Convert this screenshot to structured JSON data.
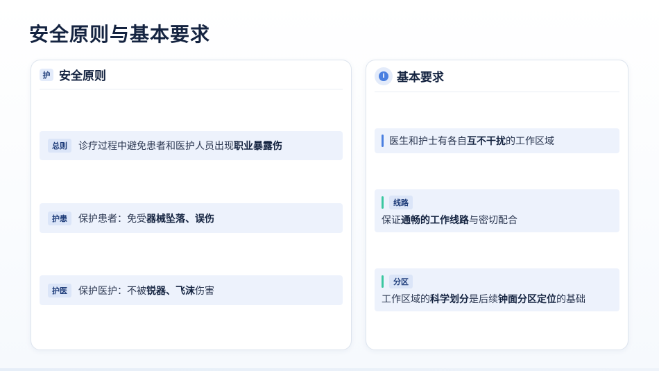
{
  "page": {
    "title": "安全原则与基本要求"
  },
  "left_card": {
    "icon_text": "护",
    "title": "安全原则",
    "rows": [
      {
        "tag": "总则",
        "text_pre": "诊疗过程中避免患者和医护人员出现",
        "text_bold": "职业暴露伤",
        "text_post": ""
      },
      {
        "tag": "护患",
        "text_pre": "保护患者：免受",
        "text_bold": "器械坠落、误伤",
        "text_post": ""
      },
      {
        "tag": "护医",
        "text_pre": "保护医护：不被",
        "text_bold": "锐器、飞沫",
        "text_post": "伤害"
      }
    ]
  },
  "right_card": {
    "icon_name": "info-icon",
    "icon_text": "i",
    "title": "基本要求",
    "item1": {
      "text_pre": "医生和护士有各自",
      "text_bold": "互不干扰",
      "text_post": "的工作区域"
    },
    "item2": {
      "tag": "线路",
      "text_pre": "保证",
      "text_bold": "通畅的工作线路",
      "text_post": "与密切配合"
    },
    "item3": {
      "tag": "分区",
      "text_pre": "工作区域的",
      "text_bold1": "科学划分",
      "text_mid": "是后续",
      "text_bold2": "钟面分区定位",
      "text_post": "的基础"
    }
  },
  "colors": {
    "accent_blue": "#4a7fe0",
    "accent_green": "#3ac7a0",
    "row_bg": "#edf2fc",
    "title": "#142340"
  }
}
